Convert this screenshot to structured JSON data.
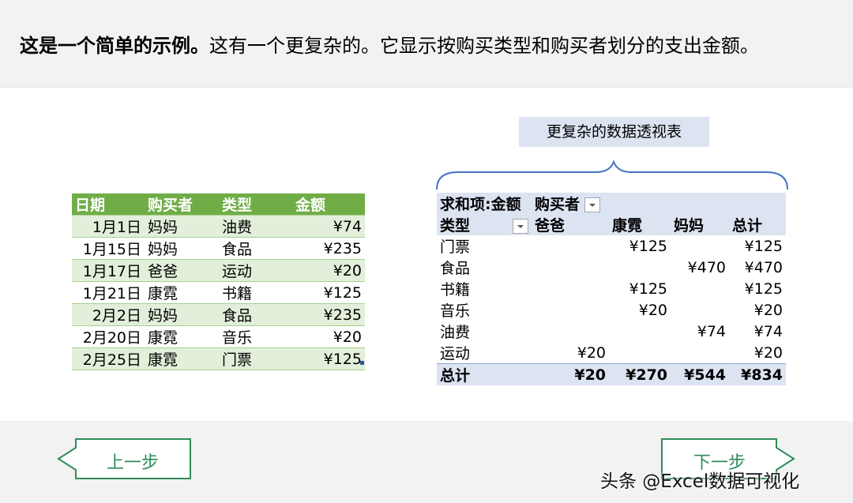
{
  "intro": {
    "bold": "这是一个简单的示例。",
    "rest": "这有一个更复杂的。它显示按购买类型和购买者划分的支出金额。"
  },
  "callout": "更复杂的数据透视表",
  "source_table": {
    "headers": [
      "日期",
      "购买者",
      "类型",
      "金额"
    ],
    "rows": [
      [
        "1月1日",
        "妈妈",
        "油费",
        "¥74"
      ],
      [
        "1月15日",
        "妈妈",
        "食品",
        "¥235"
      ],
      [
        "1月17日",
        "爸爸",
        "运动",
        "¥20"
      ],
      [
        "1月21日",
        "康霓",
        "书籍",
        "¥125"
      ],
      [
        "2月2日",
        "妈妈",
        "食品",
        "¥235"
      ],
      [
        "2月20日",
        "康霓",
        "音乐",
        "¥20"
      ],
      [
        "2月25日",
        "康霓",
        "门票",
        "¥125"
      ]
    ]
  },
  "pivot": {
    "value_label": "求和项:金额",
    "column_field": "购买者",
    "row_field": "类型",
    "columns": [
      "爸爸",
      "康霓",
      "妈妈",
      "总计"
    ],
    "rows": [
      {
        "label": "门票",
        "values": [
          "",
          "¥125",
          "",
          "¥125"
        ]
      },
      {
        "label": "食品",
        "values": [
          "",
          "",
          "¥470",
          "¥470"
        ]
      },
      {
        "label": "书籍",
        "values": [
          "",
          "¥125",
          "",
          "¥125"
        ]
      },
      {
        "label": "音乐",
        "values": [
          "",
          "¥20",
          "",
          "¥20"
        ]
      },
      {
        "label": "油费",
        "values": [
          "",
          "",
          "¥74",
          "¥74"
        ]
      },
      {
        "label": "运动",
        "values": [
          "¥20",
          "",
          "",
          "¥20"
        ]
      }
    ],
    "total_label": "总计",
    "totals": [
      "¥20",
      "¥270",
      "¥544",
      "¥834"
    ]
  },
  "nav": {
    "prev_label": "上一步",
    "next_label": "下一步"
  },
  "watermark": "头条 @Excel数据可视化",
  "colors": {
    "green_header": "#70ad47",
    "green_band": "#e2efda",
    "pivot_band": "#dce3f1",
    "nav_green": "#2e8b57"
  }
}
